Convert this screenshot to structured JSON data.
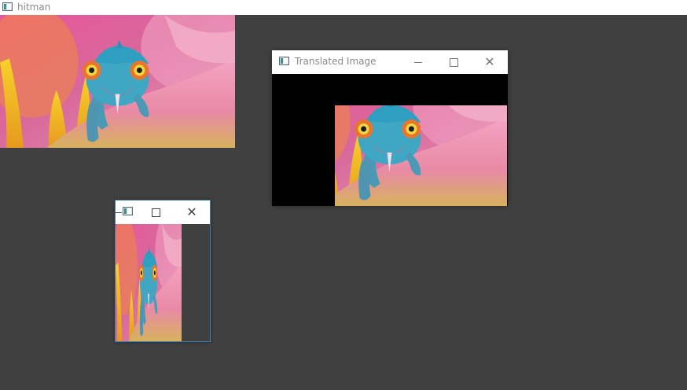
{
  "main_window": {
    "title": "hitman",
    "icon": "opencv-window-icon"
  },
  "translated_window": {
    "title": "Translated Image",
    "icon": "opencv-window-icon",
    "controls": [
      "minimize-icon",
      "maximize-icon",
      "close-icon"
    ]
  },
  "small_window": {
    "title": "",
    "icon": "opencv-window-icon",
    "controls": [
      "minimize-icon",
      "maximize-icon",
      "close-icon"
    ],
    "border_color": "#3c7fb1"
  },
  "colors": {
    "desktop": "#404040",
    "titlebar": "#ffffff",
    "title_text": "#8a8a8a",
    "image_background": "#000000"
  }
}
